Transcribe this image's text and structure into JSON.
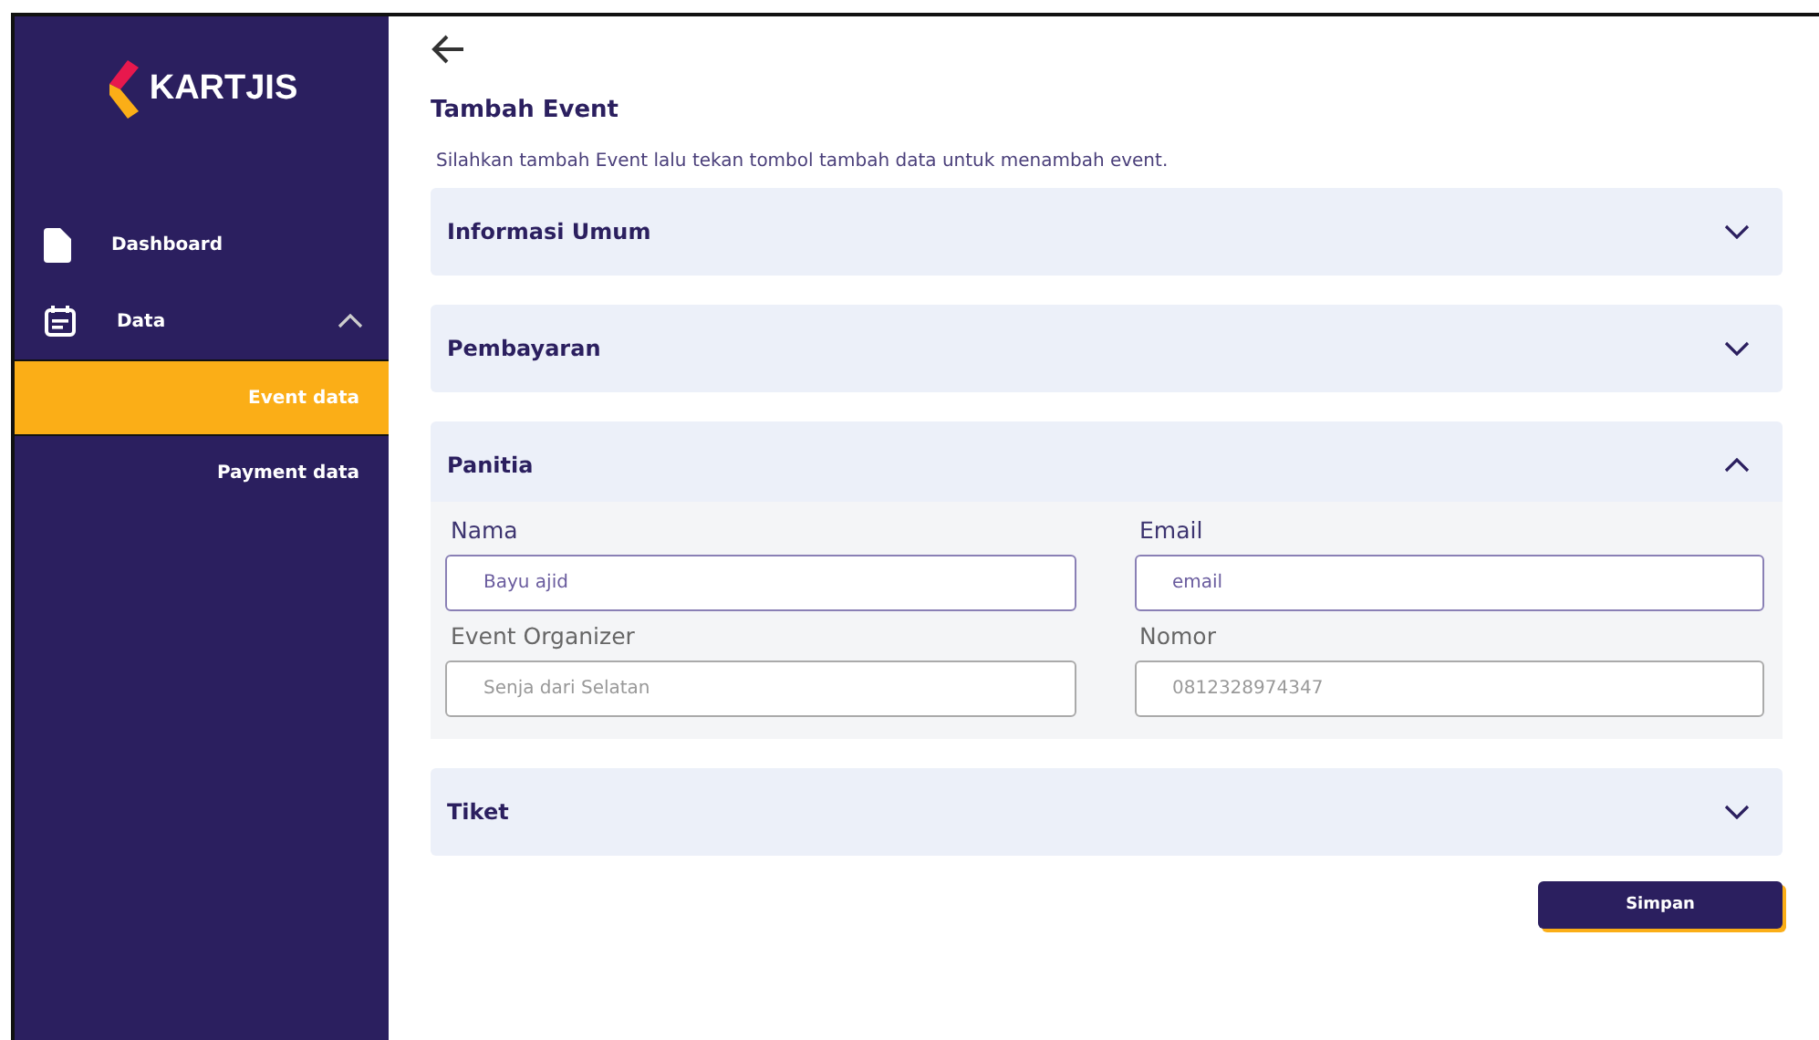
{
  "sidebar": {
    "brand": "KARTJIS",
    "items": [
      {
        "label": "Dashboard",
        "kind": "page",
        "selected": false
      },
      {
        "label": "Data",
        "kind": "group",
        "expanded": true,
        "selected": false,
        "children": [
          {
            "label": "Event data",
            "selected": true
          },
          {
            "label": "Payment data",
            "selected": false
          }
        ]
      }
    ]
  },
  "page": {
    "title": "Tambah Event",
    "description": "Silahkan tambah Event lalu tekan tombol tambah data untuk menambah event."
  },
  "sections": [
    {
      "title": "Informasi Umum",
      "expanded": false
    },
    {
      "title": "Pembayaran",
      "expanded": false
    },
    {
      "title": "Panitia",
      "expanded": true,
      "fields": [
        {
          "label": "Nama",
          "placeholder": "Bayu ajid",
          "highlighted": true
        },
        {
          "label": "Email",
          "placeholder": "email",
          "highlighted": true
        },
        {
          "label": "Event Organizer",
          "placeholder": "Senja dari Selatan",
          "highlighted": false
        },
        {
          "label": "Nomor",
          "placeholder": "0812328974347",
          "highlighted": false
        }
      ]
    },
    {
      "title": "Tiket",
      "expanded": false
    }
  ],
  "buttons": [
    "Simpan"
  ]
}
